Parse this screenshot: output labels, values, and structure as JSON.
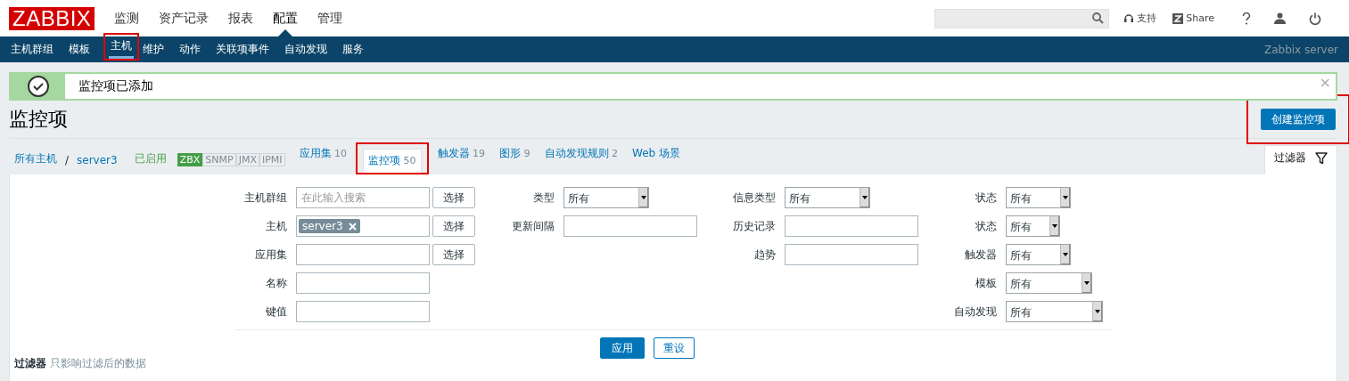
{
  "header": {
    "logo": "ZABBIX",
    "menu": [
      {
        "label": "监测",
        "selected": false
      },
      {
        "label": "资产记录",
        "selected": false
      },
      {
        "label": "报表",
        "selected": false
      },
      {
        "label": "配置",
        "selected": true
      },
      {
        "label": "管理",
        "selected": false
      }
    ],
    "support": "支持",
    "share": "Share"
  },
  "subnav": {
    "items": [
      {
        "label": "主机群组",
        "selected": false,
        "annotated": false
      },
      {
        "label": "模板",
        "selected": false,
        "annotated": false
      },
      {
        "label": "主机",
        "selected": true,
        "annotated": true
      },
      {
        "label": "维护",
        "selected": false,
        "annotated": false
      },
      {
        "label": "动作",
        "selected": false,
        "annotated": false
      },
      {
        "label": "关联项事件",
        "selected": false,
        "annotated": false
      },
      {
        "label": "自动发现",
        "selected": false,
        "annotated": false
      },
      {
        "label": "服务",
        "selected": false,
        "annotated": false
      }
    ],
    "server": "Zabbix server"
  },
  "message": {
    "kind": "success",
    "text": "监控项已添加",
    "close": "×"
  },
  "page_title": "监控项",
  "create_button": {
    "label": "创建监控项",
    "annotated": true
  },
  "breadcrumb": {
    "items": [
      "所有主机",
      "server3"
    ],
    "separator": "/"
  },
  "host_status": "已启用",
  "availability": [
    {
      "label": "ZBX",
      "active": true
    },
    {
      "label": "SNMP",
      "active": false
    },
    {
      "label": "JMX",
      "active": false
    },
    {
      "label": "IPMI",
      "active": false
    }
  ],
  "tabs": [
    {
      "label": "应用集",
      "count": "10",
      "selected": false,
      "annotated": false
    },
    {
      "label": "监控项",
      "count": "50",
      "selected": true,
      "annotated": true
    },
    {
      "label": "触发器",
      "count": "19",
      "selected": false,
      "annotated": false
    },
    {
      "label": "图形",
      "count": "9",
      "selected": false,
      "annotated": false
    },
    {
      "label": "自动发现规则",
      "count": "2",
      "selected": false,
      "annotated": false
    },
    {
      "label": "Web 场景",
      "selected": false,
      "annotated": false
    }
  ],
  "filter_tab": {
    "label": "过滤器"
  },
  "filter": {
    "columns": [
      [
        {
          "label": "主机群组",
          "kind": "text",
          "placeholder": "在此输入搜索",
          "select_button": "选择"
        },
        {
          "label": "主机",
          "kind": "multiselect",
          "chip": "server3",
          "select_button": "选择"
        },
        {
          "label": "应用集",
          "kind": "text",
          "select_button": "选择"
        },
        {
          "label": "名称",
          "kind": "text"
        },
        {
          "label": "键值",
          "kind": "text"
        }
      ],
      [
        {
          "label": "类型",
          "kind": "select",
          "value": "所有"
        },
        {
          "label": "更新间隔",
          "kind": "text"
        }
      ],
      [
        {
          "label": "信息类型",
          "kind": "select",
          "value": "所有"
        },
        {
          "label": "历史记录",
          "kind": "text"
        },
        {
          "label": "趋势",
          "kind": "text"
        }
      ],
      [
        {
          "label": "状态",
          "kind": "select",
          "value": "所有"
        },
        {
          "label": "状态",
          "kind": "select",
          "value": "所有"
        },
        {
          "label": "触发器",
          "kind": "select",
          "value": "所有"
        },
        {
          "label": "模板",
          "kind": "select",
          "value": "所有"
        },
        {
          "label": "自动发现",
          "kind": "select",
          "value": "所有"
        }
      ]
    ],
    "apply": "应用",
    "reset": "重设"
  },
  "note": {
    "label": "过滤器",
    "text": "只影响过滤后的数据"
  }
}
